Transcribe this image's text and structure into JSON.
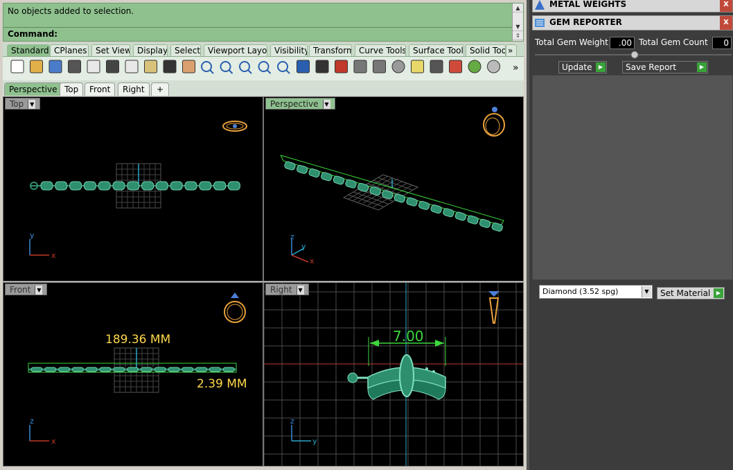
{
  "command": {
    "history": "No objects added to selection.",
    "prompt": "Command:"
  },
  "toolbar_tabs": [
    "Standard",
    "CPlanes",
    "Set View",
    "Display",
    "Select",
    "Viewport Layout",
    "Visibility",
    "Transform",
    "Curve Tools",
    "Surface Tools",
    "Solid Too"
  ],
  "toolbar_overflow": "»",
  "icons": [
    "new-file-icon",
    "open-folder-icon",
    "save-icon",
    "print-icon",
    "import-icon",
    "cut-icon",
    "copy-icon",
    "paste-icon",
    "undo-icon",
    "pan-hand-icon",
    "rotate-view-icon",
    "zoom-icon",
    "zoom-window-icon",
    "zoom-extents-icon",
    "zoom-selected-icon",
    "undo-view-icon",
    "four-viewports-icon",
    "car-icon",
    "dimension-icon",
    "snap-icon",
    "light-icon",
    "bulb-icon",
    "lock-icon",
    "material-icon",
    "color-wheel-icon",
    "sphere-icon"
  ],
  "viewport_tabs": [
    "Perspective",
    "Top",
    "Front",
    "Right"
  ],
  "viewport_tab_add": "+",
  "viewports": {
    "top": {
      "title": "Top",
      "axis1": "y",
      "axis2": "x"
    },
    "perspective": {
      "title": "Perspective",
      "axis1": "z",
      "axis2": "y",
      "axis3": "x"
    },
    "front": {
      "title": "Front",
      "axis1": "z",
      "axis2": "x",
      "dim_length": "189.36 MM",
      "dim_height": "2.39 MM"
    },
    "right": {
      "title": "Right",
      "axis1": "z",
      "axis2": "y",
      "dim_width": "7.00"
    }
  },
  "right_panel": {
    "metal_weights": "METAL WEIGHTS",
    "gem_reporter": "GEM REPORTER",
    "total_gem_weight_label": "Total Gem Weight",
    "total_gem_weight_value": ".00",
    "total_gem_count_label": "Total Gem Count",
    "total_gem_count_value": "0",
    "update": "Update",
    "save_report": "Save Report",
    "material": "Diamond     (3.52 spg)",
    "set_material": "Set Material",
    "close": "X"
  },
  "colors": {
    "accent_green": "#8fc18f",
    "chain_green": "#2e8f6e",
    "dimension_yellow": "#ffd84a",
    "dimension_green": "#3cd83c"
  }
}
